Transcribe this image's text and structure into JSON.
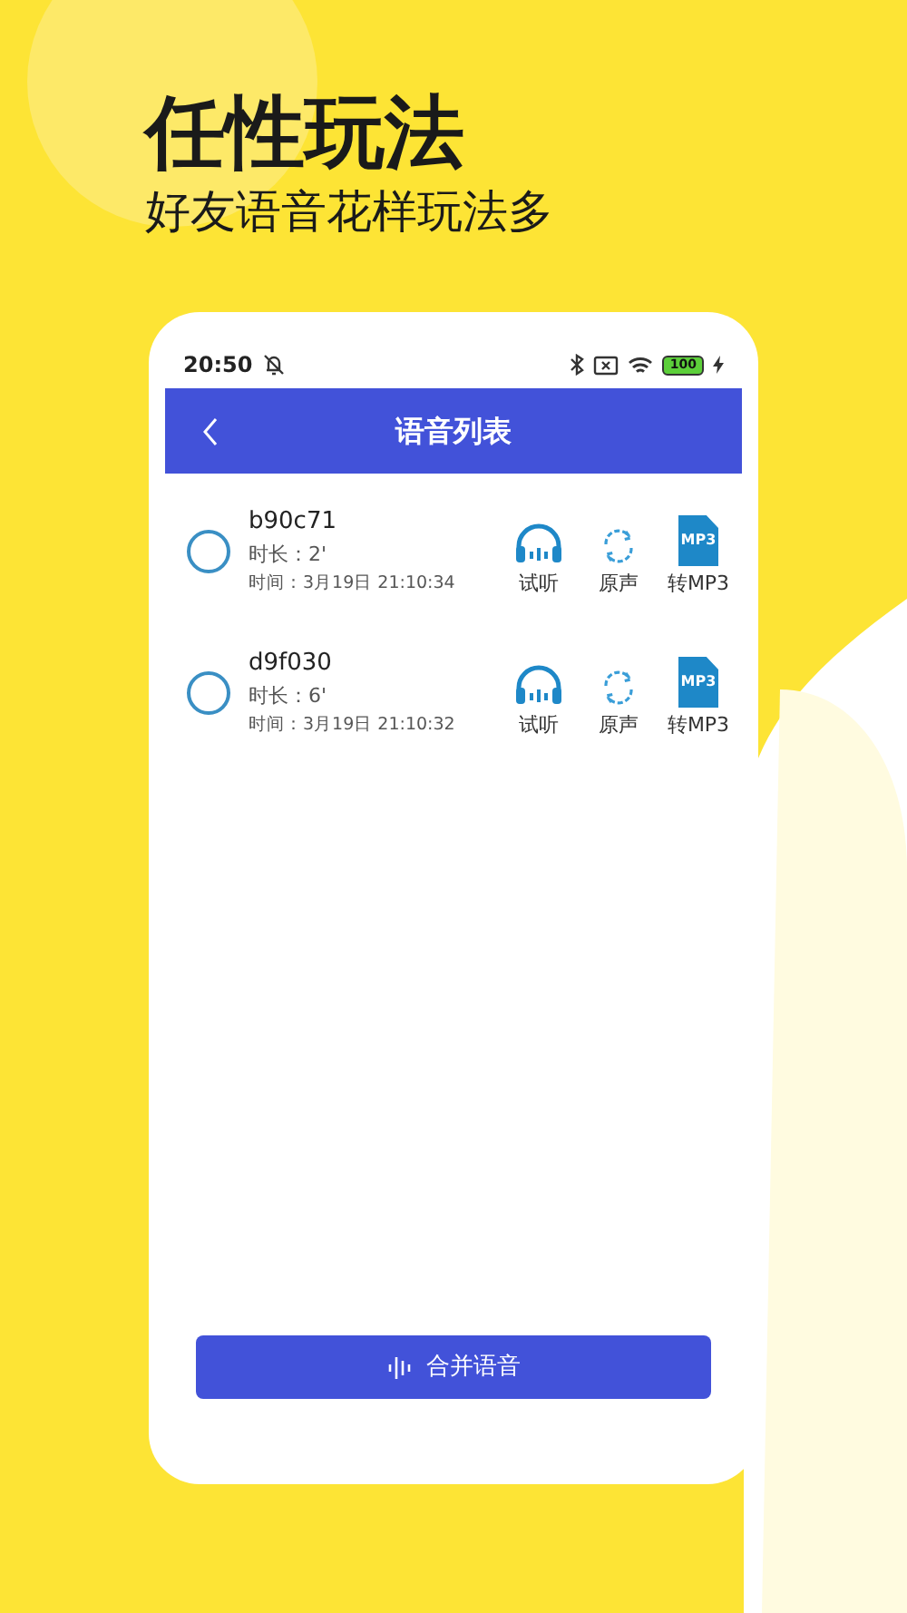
{
  "headline": "任性玩法",
  "subtitle": "好友语音花样玩法多",
  "status_bar": {
    "time": "20:50",
    "battery": "100"
  },
  "header": {
    "title": "语音列表"
  },
  "recordings": [
    {
      "name": "b90c71",
      "duration": "时长：2'",
      "time": "时间：3月19日 21:10:34",
      "checked": false,
      "actions": [
        {
          "kind": "listen",
          "label": "试听"
        },
        {
          "kind": "original",
          "label": "原声"
        },
        {
          "kind": "mp3",
          "label": "转MP3",
          "badge": "MP3"
        }
      ]
    },
    {
      "name": "d9f030",
      "duration": "时长：6'",
      "time": "时间：3月19日 21:10:32",
      "checked": false,
      "actions": [
        {
          "kind": "listen",
          "label": "试听"
        },
        {
          "kind": "original",
          "label": "原声"
        },
        {
          "kind": "mp3",
          "label": "转MP3",
          "badge": "MP3"
        }
      ]
    }
  ],
  "merge_button": "合并语音"
}
